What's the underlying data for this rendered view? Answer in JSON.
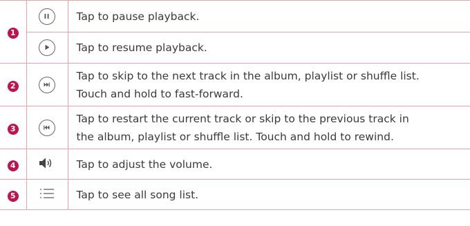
{
  "rows": [
    {
      "number": "1",
      "icon": "pause-icon",
      "text": "Tap to pause playback."
    },
    {
      "number": "",
      "icon": "play-icon",
      "text": "Tap to resume playback."
    },
    {
      "number": "2",
      "icon": "skip-next-icon",
      "text_line1": "Tap to skip to the next track in the album, playlist or shuffle list.",
      "text_line2": "Touch and hold to fast-forward."
    },
    {
      "number": "3",
      "icon": "skip-previous-icon",
      "text_line1": "Tap to restart the current track or skip to the previous track in",
      "text_line2": "the album, playlist or shuffle list. Touch and hold to rewind."
    },
    {
      "number": "4",
      "icon": "volume-icon",
      "text": "Tap to adjust the volume."
    },
    {
      "number": "5",
      "icon": "song-list-icon",
      "text": "Tap to see all song list."
    }
  ],
  "colors": {
    "rule": "#e8a4a3",
    "badge": "#c0124d",
    "text": "#3a3a3a",
    "icon": "#555555"
  }
}
